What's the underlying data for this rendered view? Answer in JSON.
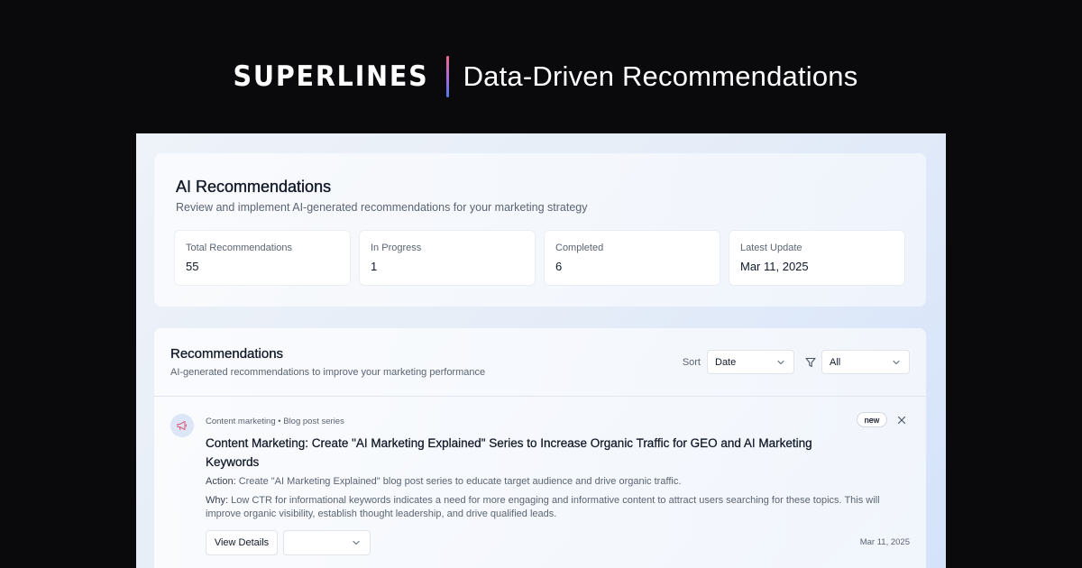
{
  "hero": {
    "logo": "SUPERLINES",
    "title": "Data-Driven Recommendations"
  },
  "summary": {
    "title": "AI Recommendations",
    "subtitle": "Review and implement AI-generated recommendations for your marketing strategy",
    "stats": [
      {
        "label": "Total Recommendations",
        "value": "55"
      },
      {
        "label": "In Progress",
        "value": "1"
      },
      {
        "label": "Completed",
        "value": "6"
      },
      {
        "label": "Latest Update",
        "value": "Mar 11, 2025"
      }
    ]
  },
  "recommendations": {
    "title": "Recommendations",
    "subtitle": "AI-generated recommendations to improve your marketing performance",
    "sort_label": "Sort",
    "sort_value": "Date",
    "filter_value": "All",
    "items": [
      {
        "icon": "megaphone-icon",
        "meta": "Content marketing • Blog post series",
        "badge": "new",
        "title": "Content Marketing: Create \"AI Marketing Explained\" Series to Increase Organic Traffic for GEO and AI Marketing Keywords",
        "action_label": "Action:",
        "action_text": "Create \"AI Marketing Explained\" blog post series to educate target audience and drive organic traffic.",
        "why_label": "Why:",
        "why_text": "Low CTR for informational keywords indicates a need for more engaging and informative content to attract users searching for these topics. This will improve organic visibility, establish thought leadership, and drive qualified leads.",
        "details_label": "View Details",
        "status_value": "",
        "date": "Mar 11, 2025"
      }
    ]
  }
}
